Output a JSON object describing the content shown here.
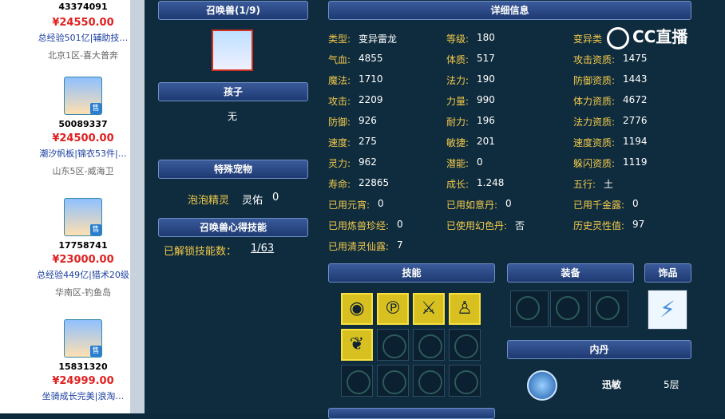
{
  "listings": [
    {
      "id": "43374091",
      "price": "¥24550.00",
      "tags": "总经验501亿|辅助技…",
      "server": "北京1区-喜大普奔",
      "sell": ""
    },
    {
      "id": "50089337",
      "price": "¥24500.00",
      "tags": "潮汐帆板|锦衣53件|…",
      "server": "山东5区-威海卫",
      "sell": "售"
    },
    {
      "id": "17758741",
      "price": "¥23000.00",
      "tags": "总经验449亿|猎术20级",
      "server": "华南区-钓鱼岛",
      "sell": "售"
    },
    {
      "id": "15831320",
      "price": "¥24999.00",
      "tags": "坐骑成长完美|浪淘…",
      "server": "",
      "sell": "售"
    }
  ],
  "left_panel": {
    "summon_title": "召唤兽(1/9)",
    "child_title": "孩子",
    "child_value": "无",
    "special_title": "特殊宠物",
    "special_name": "泡泡精灵",
    "special_label": "灵佑",
    "special_value": "0",
    "skill_title": "召唤兽心得技能",
    "unlock_label": "已解锁技能数：",
    "unlock_value": "1/63"
  },
  "detail": {
    "title": "详细信息",
    "col1": [
      {
        "k": "类型:",
        "v": "变异雷龙"
      },
      {
        "k": "气血:",
        "v": "4855"
      },
      {
        "k": "魔法:",
        "v": "1710"
      },
      {
        "k": "攻击:",
        "v": "2209"
      },
      {
        "k": "防御:",
        "v": "926"
      },
      {
        "k": "速度:",
        "v": "275"
      },
      {
        "k": "灵力:",
        "v": "962"
      },
      {
        "k": "寿命:",
        "v": "22865"
      },
      {
        "k": "已用元宵:",
        "v": "0"
      },
      {
        "k": "已用炼兽珍经:",
        "v": "0"
      },
      {
        "k": "已用清灵仙露:",
        "v": "7"
      }
    ],
    "col2": [
      {
        "k": "等级:",
        "v": "180"
      },
      {
        "k": "体质:",
        "v": "517"
      },
      {
        "k": "法力:",
        "v": "190"
      },
      {
        "k": "力量:",
        "v": "990"
      },
      {
        "k": "耐力:",
        "v": "196"
      },
      {
        "k": "敏捷:",
        "v": "201"
      },
      {
        "k": "潜能:",
        "v": "0"
      },
      {
        "k": "成长:",
        "v": "1.248"
      },
      {
        "k": "已用如意丹:",
        "v": "0"
      },
      {
        "k": "已使用幻色丹:",
        "v": "否"
      }
    ],
    "col3": [
      {
        "k": "变异类",
        "v": ""
      },
      {
        "k": "攻击资质:",
        "v": "1475"
      },
      {
        "k": "防御资质:",
        "v": "1443"
      },
      {
        "k": "体力资质:",
        "v": "4672"
      },
      {
        "k": "法力资质:",
        "v": "2776"
      },
      {
        "k": "速度资质:",
        "v": "1194"
      },
      {
        "k": "躲闪资质:",
        "v": "1119"
      },
      {
        "k": "五行:",
        "v": "土"
      },
      {
        "k": "已用千金露:",
        "v": "0"
      },
      {
        "k": "历史灵性值:",
        "v": "97"
      }
    ]
  },
  "sections": {
    "skills": "技能",
    "equip": "装备",
    "ornament": "饰品",
    "neidan": "内丹"
  },
  "neidan": [
    {
      "name": "迅敏",
      "level": "5层"
    }
  ],
  "logo": "CC直播"
}
